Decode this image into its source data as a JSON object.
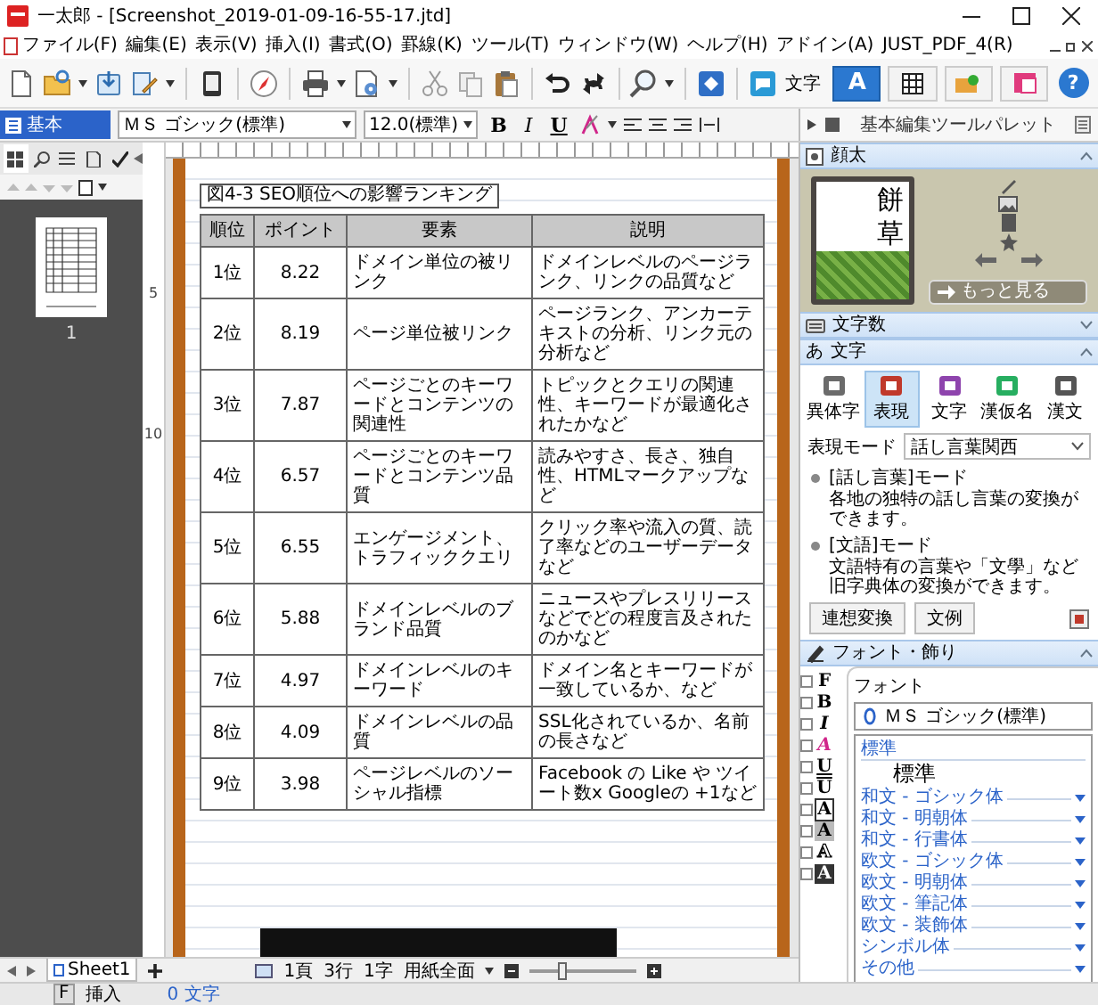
{
  "window": {
    "title": "一太郎 - [Screenshot_2019-01-09-16-55-17.jtd]"
  },
  "menu": [
    "ファイル(F)",
    "編集(E)",
    "表示(V)",
    "挿入(I)",
    "書式(O)",
    "罫線(K)",
    "ツール(T)",
    "ウィンドウ(W)",
    "ヘルプ(H)",
    "アドイン(A)",
    "JUST_PDF_4(R)"
  ],
  "toolbar": {
    "mode_label": "文字",
    "mode_tabs": [
      {
        "kind": "text",
        "label": "A",
        "selected": true
      },
      {
        "kind": "grid",
        "selected": false
      },
      {
        "kind": "cards",
        "selected": false
      },
      {
        "kind": "picture",
        "selected": false
      },
      {
        "kind": "help",
        "label": "?",
        "selected": false
      }
    ]
  },
  "format_bar": {
    "style": "基本",
    "font": "ＭＳ ゴシック(標準)",
    "size": "12.0(標準)",
    "buttons": [
      "B",
      "I",
      "U"
    ],
    "palette_title": "基本編集ツールパレット"
  },
  "left_panel": {
    "tabs": [
      {
        "selected": true
      },
      {
        "selected": false
      },
      {
        "selected": false
      },
      {
        "selected": false
      },
      {
        "selected": false
      }
    ],
    "page_number": "1"
  },
  "document": {
    "ruler_labels": [
      "5",
      "10"
    ],
    "caption": "図4-3 SEO順位への影響ランキング",
    "columns": [
      "順位",
      "ポイント",
      "要素",
      "説明"
    ],
    "rows": [
      {
        "rank": "1位",
        "points": "8.22",
        "factor": "ドメイン単位の被リンク",
        "description": "ドメインレベルのページランク、リンクの品質など"
      },
      {
        "rank": "2位",
        "points": "8.19",
        "factor": "ページ単位被リンク",
        "description": "ページランク、アンカーテキストの分析、リンク元の分析など"
      },
      {
        "rank": "3位",
        "points": "7.87",
        "factor": "ページごとのキーワードとコンテンツの関連性",
        "description": "トピックとクエリの関連性、キーワードが最適化されたかなど"
      },
      {
        "rank": "4位",
        "points": "6.57",
        "factor": "ページごとのキーワードとコンテンツ品質",
        "description": "読みやすさ、長さ、独自性、HTMLマークアップなど"
      },
      {
        "rank": "5位",
        "points": "6.55",
        "factor": "エンゲージメント、トラフィッククエリ",
        "description": "クリック率や流入の質、読了率などのユーザーデータなど"
      },
      {
        "rank": "6位",
        "points": "5.88",
        "factor": "ドメインレベルのブランド品質",
        "description": "ニュースやプレスリリースなどでどの程度言及されたのかなど"
      },
      {
        "rank": "7位",
        "points": "4.97",
        "factor": "ドメインレベルのキーワード",
        "description": "ドメイン名とキーワードが一致しているか、など"
      },
      {
        "rank": "8位",
        "points": "4.09",
        "factor": "ドメインレベルの品質",
        "description": "SSL化されているか、名前の長さなど"
      },
      {
        "rank": "9位",
        "points": "3.98",
        "factor": "ページレベルのソーシャル指標",
        "description": "Facebook の Like や ツイート数x Googleの +1など"
      }
    ]
  },
  "sheet_bar": {
    "sheet": "Sheet1",
    "page": "1頁",
    "line": "3行",
    "char": "1字",
    "view": "用紙全面",
    "zoom": {
      "level": 0.3
    }
  },
  "status_bar": {
    "key": "F",
    "mode": "挿入",
    "count": "0 文字"
  },
  "palette": {
    "sections": [
      {
        "kind": "image",
        "title": "顔太",
        "expanded": true,
        "vertical_text": "餅草",
        "more_button": "もっと見る"
      },
      {
        "kind": "count",
        "title": "文字数",
        "expanded": false
      },
      {
        "kind": "characters",
        "title": "文字",
        "icon_text": "あ",
        "expanded": true,
        "tools": [
          {
            "label": "異体字",
            "selected": false
          },
          {
            "label": "表現",
            "selected": true
          },
          {
            "label": "文字",
            "selected": false
          },
          {
            "label": "漢仮名",
            "selected": false
          },
          {
            "label": "漢文",
            "selected": false
          }
        ],
        "mode_label": "表現モード",
        "mode": "話し言葉関西",
        "modes": [
          {
            "name": "[話し言葉]モード",
            "description": "各地の独特の話し言葉の変換ができます。"
          },
          {
            "name": "[文語]モード",
            "description": "文語特有の言葉や「文學」など旧字典体の変換ができます。"
          }
        ],
        "buttons": [
          "連想変換",
          "文例"
        ]
      },
      {
        "kind": "font",
        "title": "フォント・飾り",
        "expanded": true,
        "tools": [
          {
            "kind": "font",
            "glyph": "F",
            "checked": false
          },
          {
            "kind": "bold",
            "glyph": "B",
            "checked": false
          },
          {
            "kind": "italic",
            "glyph": "I",
            "checked": false
          },
          {
            "kind": "color",
            "glyph": "A",
            "checked": false
          },
          {
            "kind": "underline",
            "glyph": "U",
            "checked": false
          },
          {
            "kind": "overline",
            "glyph": "U",
            "checked": false
          },
          {
            "kind": "boxed",
            "glyph": "A",
            "checked": false
          },
          {
            "kind": "shaded",
            "glyph": "A",
            "checked": false
          },
          {
            "kind": "outline",
            "glyph": "A",
            "checked": false
          },
          {
            "kind": "inverse",
            "glyph": "A",
            "checked": false
          }
        ],
        "heading": "フォント",
        "font": "ＭＳ ゴシック(標準)",
        "group": "標準",
        "current": "標準",
        "categories": [
          "和文 - ゴシック体",
          "和文 - 明朝体",
          "和文 - 行書体",
          "欧文 - ゴシック体",
          "欧文 - 明朝体",
          "欧文 - 筆記体",
          "欧文 - 装飾体",
          "シンボル体",
          "その他"
        ]
      }
    ]
  }
}
